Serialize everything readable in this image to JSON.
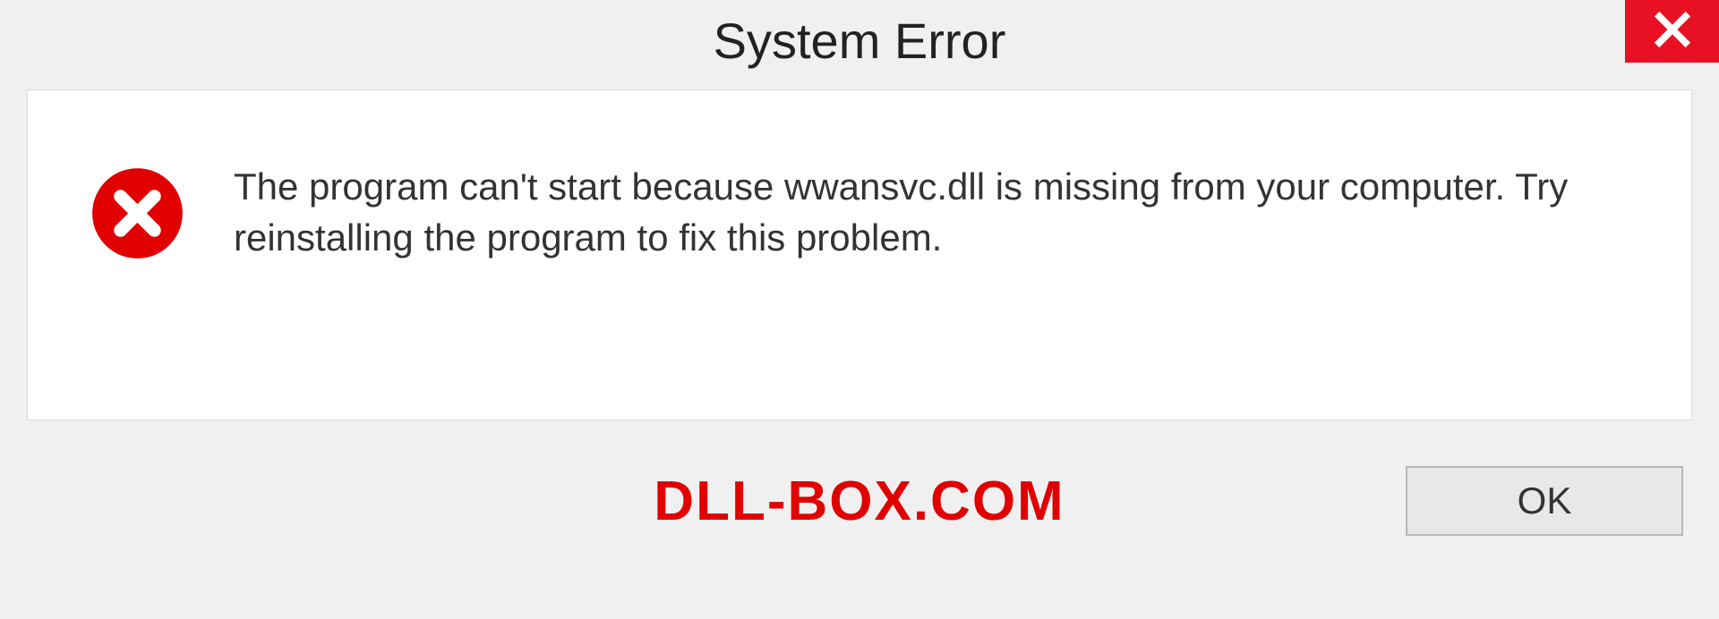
{
  "dialog": {
    "title": "System Error",
    "message": "The program can't start because wwansvc.dll is missing from your computer. Try reinstalling the program to fix this problem.",
    "ok_label": "OK"
  },
  "watermark": "DLL-BOX.COM",
  "colors": {
    "close_button": "#e81123",
    "error_icon": "#e00000",
    "watermark": "#e00000"
  }
}
